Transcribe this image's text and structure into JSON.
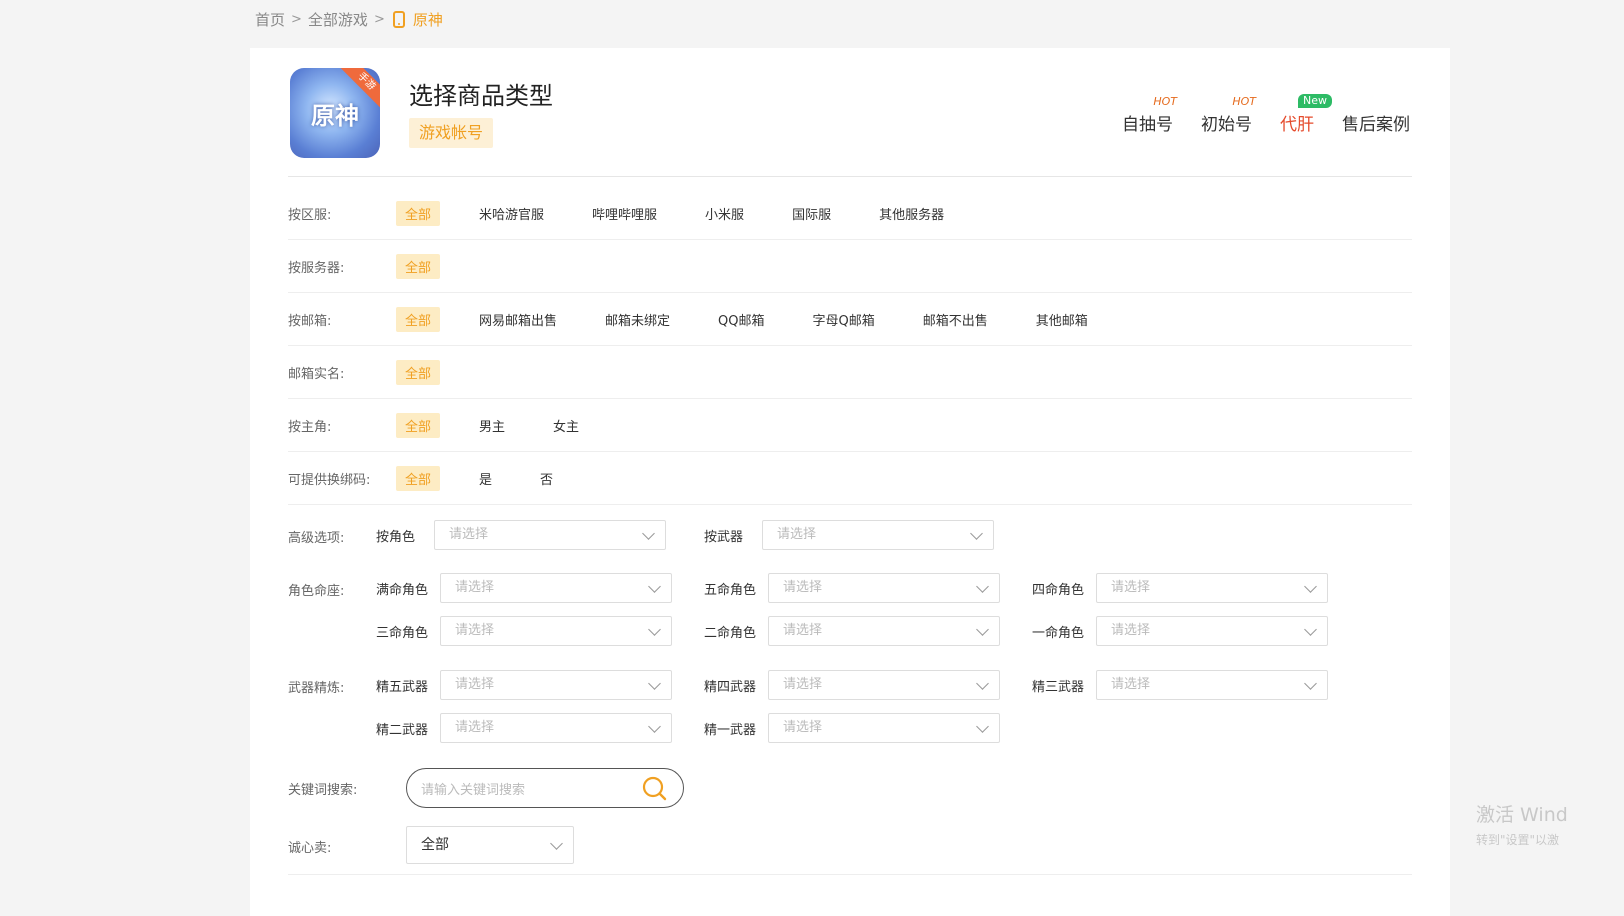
{
  "breadcrumb": {
    "home": "首页",
    "all_games": "全部游戏",
    "current": "原神"
  },
  "header": {
    "logo_text": "原神",
    "logo_ribbon": "手游",
    "title": "选择商品类型",
    "type_tag": "游戏帐号",
    "links": [
      {
        "label": "自抽号",
        "badge": "HOT"
      },
      {
        "label": "初始号",
        "badge": "HOT"
      },
      {
        "label": "代肝",
        "badge": "New"
      },
      {
        "label": "售后案例",
        "badge": ""
      }
    ]
  },
  "filters": [
    {
      "label": "按区服:",
      "options": [
        "全部",
        "米哈游官服",
        "哔哩哔哩服",
        "小米服",
        "国际服",
        "其他服务器"
      ]
    },
    {
      "label": "按服务器:",
      "options": [
        "全部"
      ]
    },
    {
      "label": "按邮箱:",
      "options": [
        "全部",
        "网易邮箱出售",
        "邮箱未绑定",
        "QQ邮箱",
        "字母Q邮箱",
        "邮箱不出售",
        "其他邮箱"
      ]
    },
    {
      "label": "邮箱实名:",
      "options": [
        "全部"
      ]
    },
    {
      "label": "按主角:",
      "options": [
        "全部",
        "男主",
        "女主"
      ]
    },
    {
      "label": "可提供换绑码:",
      "options": [
        "全部",
        "是",
        "否"
      ]
    }
  ],
  "advanced": {
    "label": "高级选项:",
    "role_label": "按角色",
    "weapon_label": "按武器",
    "placeholder": "请选择"
  },
  "constellation": {
    "label": "角色命座:",
    "fields": [
      "满命角色",
      "五命角色",
      "四命角色",
      "三命角色",
      "二命角色",
      "一命角色"
    ]
  },
  "refinement": {
    "label": "武器精炼:",
    "fields": [
      "精五武器",
      "精四武器",
      "精三武器",
      "精二武器",
      "精一武器"
    ]
  },
  "keyword": {
    "label": "关键词搜索:",
    "placeholder": "请输入关键词搜索"
  },
  "honest": {
    "label": "诚心卖:",
    "value": "全部"
  },
  "watermark": {
    "line1": "激活 Wind",
    "line2": "转到\"设置\"以激"
  },
  "colors": {
    "accent": "#f0a022",
    "active_link": "#e54b2c",
    "new_badge": "#2dbb65"
  }
}
